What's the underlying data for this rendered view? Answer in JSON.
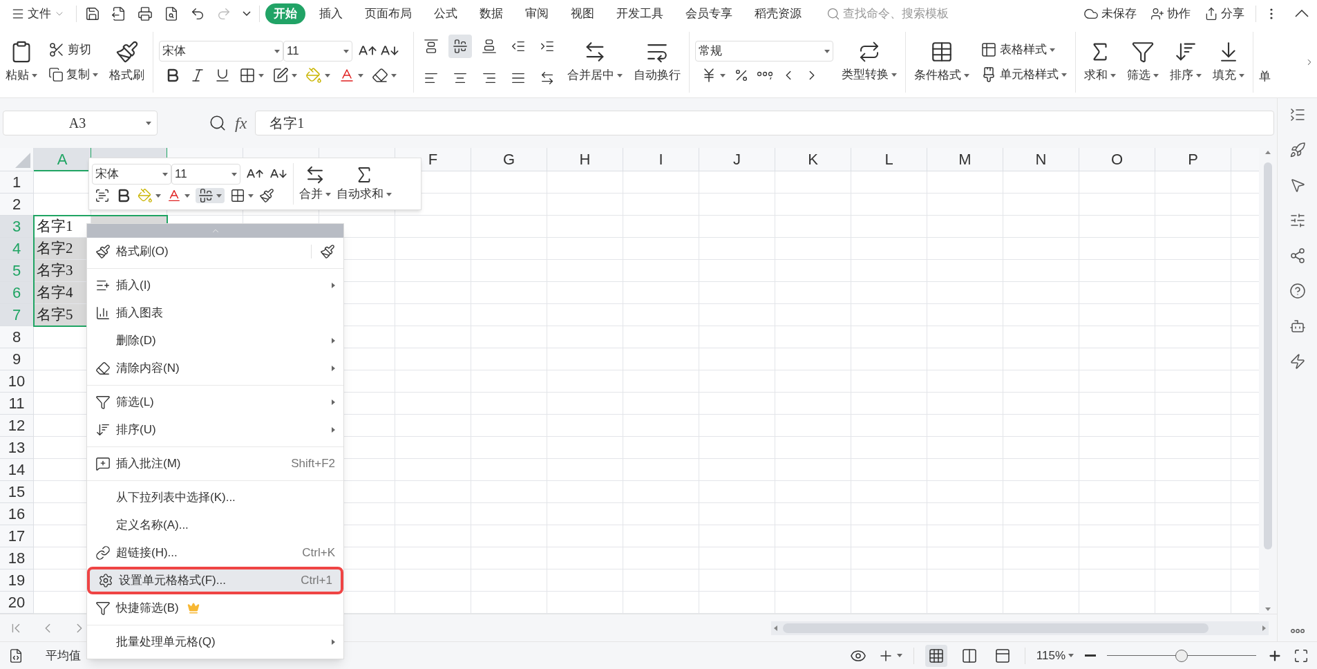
{
  "title_bar": {
    "file_menu": "文件",
    "redo": {
      "disabled": true
    },
    "tabs": [
      {
        "label": "开始",
        "selected": true
      },
      {
        "label": "插入",
        "selected": false
      },
      {
        "label": "页面布局",
        "selected": false
      },
      {
        "label": "公式",
        "selected": false
      },
      {
        "label": "数据",
        "selected": false
      },
      {
        "label": "审阅",
        "selected": false
      },
      {
        "label": "视图",
        "selected": false
      },
      {
        "label": "开发工具",
        "selected": false
      },
      {
        "label": "会员专享",
        "selected": false
      },
      {
        "label": "稻壳资源",
        "selected": false
      }
    ],
    "search": {
      "placeholder": "查找命令、搜索模板"
    },
    "save_status": "未保存",
    "collaborate": "协作",
    "share": "分享"
  },
  "ribbon": {
    "paste": "粘贴",
    "cut": "剪切",
    "copy": "复制",
    "format_painter": "格式刷",
    "font": "宋体",
    "font_size": "11",
    "align_buttons": [
      {
        "selected": false
      },
      {
        "selected": true
      },
      {
        "selected": false
      },
      {
        "selected": false
      },
      {
        "selected": false
      },
      {
        "selected": false
      },
      {
        "selected": false
      },
      {
        "selected": false
      },
      {
        "selected": false
      },
      {
        "selected": false
      }
    ],
    "merge": "合并居中",
    "wrap": "自动换行",
    "number_format": "常规",
    "convert": "类型转换",
    "conditional_format": "条件格式",
    "table_style": "表格样式",
    "cell_style": "单元格样式",
    "sum": "求和",
    "filter": "筛选",
    "sort": "排序",
    "fill": "填充",
    "button_cut_off": "单"
  },
  "formula_bar": {
    "name_box": "A3",
    "fx_label": "fx",
    "formula": "名字1"
  },
  "sheet": {
    "columns": [
      {
        "label": "A",
        "selected": true
      },
      {
        "selected": true
      },
      {
        "selected": false
      },
      {
        "selected": false
      },
      {
        "selected": false
      },
      {
        "label": "F",
        "selected": false
      },
      {
        "label": "G",
        "selected": false
      },
      {
        "label": "H",
        "selected": false
      },
      {
        "label": "I",
        "selected": false
      },
      {
        "label": "J",
        "selected": false
      },
      {
        "label": "K",
        "selected": false
      },
      {
        "label": "L",
        "selected": false
      },
      {
        "label": "M",
        "selected": false
      },
      {
        "label": "N",
        "selected": false
      },
      {
        "label": "O",
        "selected": false
      },
      {
        "label": "P",
        "selected": false
      }
    ],
    "rows": [
      {
        "label": "1",
        "selected": false
      },
      {
        "label": "2",
        "selected": false
      },
      {
        "label": "3",
        "selected": true,
        "cells": [
          {
            "text": "名字1",
            "active": true
          }
        ]
      },
      {
        "label": "4",
        "selected": true,
        "cells": [
          {
            "text": "名字2",
            "active": false
          }
        ]
      },
      {
        "label": "5",
        "selected": true,
        "cells": [
          {
            "text": "名字3",
            "active": false
          }
        ]
      },
      {
        "label": "6",
        "selected": true,
        "cells": [
          {
            "text": "名字4",
            "active": false
          }
        ]
      },
      {
        "label": "7",
        "selected": true,
        "cells": [
          {
            "text": "名字5",
            "active": false
          }
        ]
      },
      {
        "label": "8",
        "selected": false
      },
      {
        "label": "9",
        "selected": false
      },
      {
        "label": "10",
        "selected": false
      },
      {
        "label": "11",
        "selected": false
      },
      {
        "label": "12",
        "selected": false
      },
      {
        "label": "13",
        "selected": false
      },
      {
        "label": "14",
        "selected": false
      },
      {
        "label": "15",
        "selected": false
      },
      {
        "label": "16",
        "selected": false
      },
      {
        "label": "17",
        "selected": false
      },
      {
        "label": "18",
        "selected": false
      },
      {
        "label": "19",
        "selected": false
      },
      {
        "label": "20",
        "selected": false
      }
    ]
  },
  "mini_toolbar": {
    "font": "宋体",
    "font_size": "11",
    "align_selected": true,
    "merge": "合并",
    "autosum": "自动求和"
  },
  "context_menu": {
    "groups": [
      [
        {
          "label": "格式刷(O)",
          "submenu": false,
          "selected": false
        }
      ],
      [
        {
          "label": "插入(I)",
          "submenu": true,
          "selected": false
        },
        {
          "label": "插入图表",
          "submenu": false,
          "selected": false
        },
        {
          "label": "删除(D)",
          "submenu": true,
          "selected": false
        },
        {
          "label": "清除内容(N)",
          "submenu": true,
          "selected": false
        }
      ],
      [
        {
          "label": "筛选(L)",
          "submenu": true,
          "selected": false
        },
        {
          "label": "排序(U)",
          "submenu": true,
          "selected": false
        }
      ],
      [
        {
          "label": "插入批注(M)",
          "shortcut": "Shift+F2",
          "submenu": false,
          "selected": false
        }
      ],
      [
        {
          "label": "从下拉列表中选择(K)...",
          "submenu": false,
          "selected": false
        },
        {
          "label": "定义名称(A)...",
          "submenu": false,
          "selected": false
        },
        {
          "label": "超链接(H)...",
          "shortcut": "Ctrl+K",
          "submenu": false,
          "selected": false
        },
        {
          "label": "设置单元格格式(F)...",
          "shortcut": "Ctrl+1",
          "submenu": false,
          "selected": true
        },
        {
          "label": "快捷筛选(B)",
          "submenu": false,
          "selected": false,
          "premium": true
        }
      ],
      [
        {
          "label": "批量处理单元格(Q)",
          "submenu": true,
          "selected": false
        }
      ]
    ]
  },
  "status_bar": {
    "summary": "平均值",
    "zoom": "115%",
    "zoom_slider": {
      "level": 0.5
    },
    "view_buttons": [
      {
        "selected": true
      },
      {
        "selected": false
      },
      {
        "selected": false
      }
    ]
  }
}
